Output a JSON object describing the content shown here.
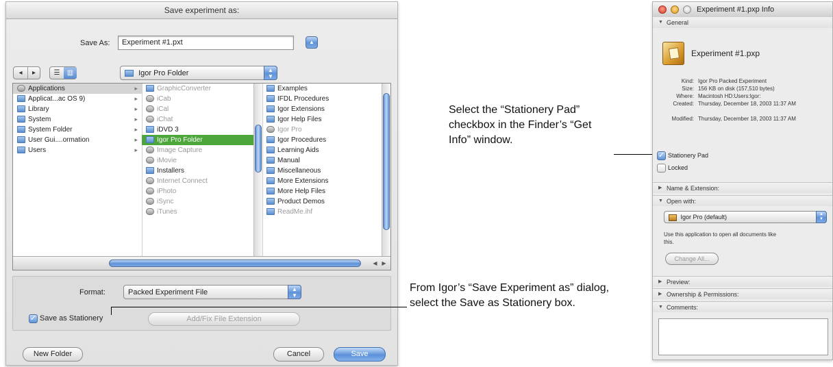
{
  "save_dialog": {
    "title": "Save experiment as:",
    "save_as_label": "Save As:",
    "filename": "Experiment #1.pxt",
    "nav_back": "◂",
    "nav_forward": "▸",
    "view_list": "☰",
    "view_columns": "▥",
    "location": "Igor Pro Folder",
    "columns": [
      [
        {
          "label": "Applications",
          "icon": "app-folder-icon",
          "selected": true,
          "chevron": true
        },
        {
          "label": "Applicat...ac OS 9)",
          "icon": "folder-icon",
          "chevron": true
        },
        {
          "label": "Library",
          "icon": "folder-icon",
          "chevron": true
        },
        {
          "label": "System",
          "icon": "folder-icon",
          "chevron": true
        },
        {
          "label": "System Folder",
          "icon": "folder-icon",
          "chevron": true
        },
        {
          "label": "User Gui....ormation",
          "icon": "folder-icon",
          "chevron": true
        },
        {
          "label": "Users",
          "icon": "folder-icon",
          "chevron": true
        }
      ],
      [
        {
          "label": "GraphicConverter",
          "icon": "folder-icon",
          "dim": true,
          "chevron": true
        },
        {
          "label": "iCab",
          "icon": "app-icon",
          "dim": true
        },
        {
          "label": "iCal",
          "icon": "app-icon",
          "dim": true
        },
        {
          "label": "iChat",
          "icon": "app-icon",
          "dim": true
        },
        {
          "label": "iDVD 3",
          "icon": "folder-icon",
          "chevron": true
        },
        {
          "label": "Igor Pro Folder",
          "icon": "folder-icon",
          "selected_active": true,
          "chevron": true
        },
        {
          "label": "Image Capture",
          "icon": "app-icon",
          "dim": true
        },
        {
          "label": "iMovie",
          "icon": "app-icon",
          "dim": true
        },
        {
          "label": "Installers",
          "icon": "folder-icon",
          "chevron": true
        },
        {
          "label": "Internet Connect",
          "icon": "app-icon",
          "dim": true
        },
        {
          "label": "iPhoto",
          "icon": "app-icon",
          "dim": true
        },
        {
          "label": "iSync",
          "icon": "app-icon",
          "dim": true
        },
        {
          "label": "iTunes",
          "icon": "app-icon",
          "dim": true
        }
      ],
      [
        {
          "label": "Examples",
          "icon": "folder-icon",
          "chevron": true
        },
        {
          "label": "IFDL Procedures",
          "icon": "folder-icon",
          "chevron": true
        },
        {
          "label": "Igor Extensions",
          "icon": "folder-icon",
          "chevron": true
        },
        {
          "label": "Igor Help Files",
          "icon": "folder-icon",
          "chevron": true
        },
        {
          "label": "Igor Pro",
          "icon": "app-icon",
          "dim": true
        },
        {
          "label": "Igor Procedures",
          "icon": "folder-icon",
          "chevron": true
        },
        {
          "label": "Learning Aids",
          "icon": "folder-icon",
          "chevron": true
        },
        {
          "label": "Manual",
          "icon": "folder-icon",
          "chevron": true
        },
        {
          "label": "Miscellaneous",
          "icon": "folder-icon",
          "chevron": true
        },
        {
          "label": "More Extensions",
          "icon": "folder-icon",
          "chevron": true
        },
        {
          "label": "More Help Files",
          "icon": "folder-icon",
          "chevron": true
        },
        {
          "label": "Product Demos",
          "icon": "folder-icon",
          "chevron": true
        },
        {
          "label": "ReadMe.ihf",
          "icon": "doc-icon",
          "dim": true
        }
      ]
    ],
    "format_label": "Format:",
    "format_value": "Packed Experiment File",
    "stationery_label": "Save as Stationery",
    "add_extension_label": "Add/Fix File Extension",
    "new_folder_label": "New Folder",
    "cancel_label": "Cancel",
    "save_label": "Save"
  },
  "callouts": {
    "finder_text": "Select the “Stationery Pad” checkbox in the Finder’s “Get Info” window.",
    "igor_text": "From Igor’s “Save Experiment as” dialog, select the Save as Stationery box."
  },
  "info_window": {
    "title": "Experiment #1.pxp Info",
    "general_label": "General",
    "file_name": "Experiment #1.pxp",
    "meta": [
      {
        "k": "Kind:",
        "v": "Igor Pro Packed Experiment"
      },
      {
        "k": "Size:",
        "v": "156 KB on disk (157,510 bytes)"
      },
      {
        "k": "Where:",
        "v": "Macintosh HD:Users:Igor:"
      },
      {
        "k": "Created:",
        "v": "Thursday, December 18, 2003 11:37 AM"
      },
      {
        "k": "Modified:",
        "v": "Thursday, December 18, 2003 11:37 AM"
      }
    ],
    "stationery_pad_label": "Stationery Pad",
    "locked_label": "Locked",
    "name_extension_label": "Name & Extension:",
    "open_with_label": "Open with:",
    "open_with_value": "Igor Pro (default)",
    "open_with_hint": "Use this application to open all documents like this.",
    "change_all_label": "Change All...",
    "preview_label": "Preview:",
    "ownership_label": "Ownership & Permissions:",
    "comments_label": "Comments:",
    "comments_value": ""
  }
}
